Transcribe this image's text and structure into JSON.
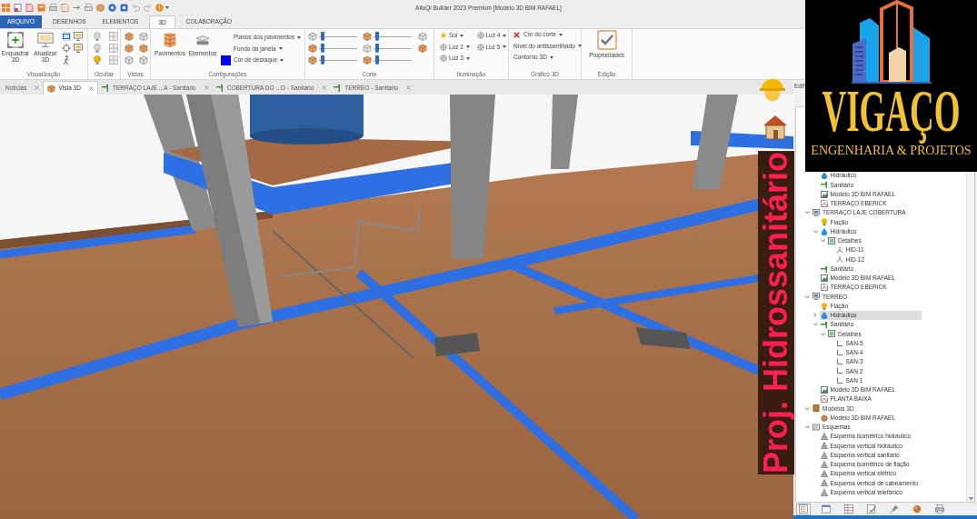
{
  "window": {
    "title": "AltoQi Builder 2023 Premium [Modelo 3D BIM RAFAEL]"
  },
  "ribbon": {
    "tabs": [
      {
        "label": "ARQUIVO",
        "kind": "file",
        "selected": false
      },
      {
        "label": "DESENHOS",
        "kind": "tab",
        "selected": false
      },
      {
        "label": "ELEMENTOS",
        "kind": "tab",
        "selected": false
      },
      {
        "label": "3D",
        "kind": "tab",
        "selected": true
      },
      {
        "label": "COLABORAÇÃO",
        "kind": "tab",
        "selected": false
      }
    ],
    "groups": [
      {
        "kind": "view",
        "label": "Visualização",
        "buttons": [
          {
            "label": "Enquadrar 3D"
          },
          {
            "label": "Atualizar 3D"
          }
        ]
      },
      {
        "kind": "hide",
        "label": "Ocultar"
      },
      {
        "kind": "views",
        "label": "Vistas"
      },
      {
        "kind": "config",
        "label": "Configurações",
        "buttons": [
          {
            "label": "Pavimentos"
          },
          {
            "label": "Elementos"
          }
        ],
        "dropdowns": [
          {
            "label": "Planos dos pavimentos"
          },
          {
            "label": "Fundo da janela"
          },
          {
            "label": "Cor de destaque",
            "color": "#0000ff"
          }
        ]
      },
      {
        "kind": "cut",
        "label": "Corte",
        "sliders": [
          {
            "level": 0.05
          },
          {
            "level": 0.05
          },
          {
            "level": 0.05
          },
          {
            "level": 0.05
          },
          {
            "level": 0.05
          },
          {
            "level": 0.05
          }
        ]
      },
      {
        "kind": "lighting",
        "label": "Iluminação",
        "lights": [
          {
            "label": "Sol",
            "kind": "sun"
          },
          {
            "label": "Luz 4",
            "kind": "lamp"
          },
          {
            "label": "Luz 2",
            "kind": "lamp"
          },
          {
            "label": "Luz 5",
            "kind": "lamp"
          },
          {
            "label": "Luz 3",
            "kind": "lamp"
          }
        ]
      },
      {
        "kind": "graphics",
        "label": "Gráfico 3D",
        "dropdowns": [
          {
            "label": "Cor do corte",
            "kind": "cutcolor"
          },
          {
            "label": "Nível do antisserrilhado",
            "kind": "plain"
          },
          {
            "label": "Contorno 3D",
            "kind": "plain"
          }
        ]
      },
      {
        "kind": "edit",
        "label": "Edição",
        "buttons": [
          {
            "label": "Propriedades"
          }
        ]
      }
    ]
  },
  "document_tabs": [
    {
      "label": "Notícias",
      "kind": "news",
      "selected": false
    },
    {
      "label": "Vista 3D",
      "kind": "view",
      "selected": true
    },
    {
      "label": "TERRAÇO LAJE ...A - Sanitário",
      "kind": "sanitary",
      "selected": false
    },
    {
      "label": "COBERTURA DO ...O - Sanitário",
      "kind": "sanitary",
      "selected": false
    },
    {
      "label": "TERREO - Sanitário",
      "kind": "sanitary",
      "selected": false
    }
  ],
  "side_panel": {
    "title": "Edif",
    "tree": [
      {
        "children": [
          {
            "label": "Hidráulico",
            "kind": "plumbing",
            "selected": false
          },
          {
            "label": "Sanitário",
            "kind": "sanitary",
            "selected": false
          },
          {
            "label": "Modelo 3D BIM RAFAEL",
            "kind": "model",
            "selected": false
          },
          {
            "label": "TERRAÇO EBERICK",
            "kind": "drawing",
            "selected": false
          }
        ]
      },
      {
        "label": "TERRAÇO LAJE COBERTURA",
        "kind": "floor",
        "selected": false,
        "expanded": true,
        "children": [
          {
            "label": "Fiação",
            "kind": "wiring",
            "selected": false
          },
          {
            "label": "Hidráulico",
            "kind": "plumbing",
            "selected": false,
            "expanded": true,
            "children": [
              {
                "label": "Detalhes",
                "kind": "details",
                "selected": false,
                "expanded": true,
                "children": [
                  {
                    "label": "HID-11",
                    "kind": "junction",
                    "selected": false
                  },
                  {
                    "label": "HID-12",
                    "kind": "junction",
                    "selected": false
                  }
                ]
              }
            ]
          },
          {
            "label": "Sanitário",
            "kind": "sanitary",
            "selected": false
          },
          {
            "label": "Modelo 3D BIM RAFAEL",
            "kind": "model",
            "selected": false
          },
          {
            "label": "TERRAÇO EBERICK",
            "kind": "drawing",
            "selected": false
          }
        ]
      },
      {
        "label": "TERREO",
        "kind": "floor",
        "selected": false,
        "expanded": true,
        "children": [
          {
            "label": "Fiação",
            "kind": "wiring",
            "selected": false
          },
          {
            "label": "Hidráulico",
            "kind": "plumbing",
            "selected": true,
            "expanded": false
          },
          {
            "label": "Sanitário",
            "kind": "sanitary",
            "selected": false,
            "expanded": true,
            "children": [
              {
                "label": "Detalhes",
                "kind": "details",
                "selected": false,
                "expanded": true,
                "children": [
                  {
                    "label": "SAN-5",
                    "kind": "elbow",
                    "selected": false
                  },
                  {
                    "label": "SAN-4",
                    "kind": "elbow",
                    "selected": false
                  },
                  {
                    "label": "SAN-3",
                    "kind": "elbow",
                    "selected": false
                  },
                  {
                    "label": "SAN 2",
                    "kind": "elbow",
                    "selected": false
                  },
                  {
                    "label": "SAN 1",
                    "kind": "elbow",
                    "selected": false
                  }
                ]
              }
            ]
          },
          {
            "label": "Modelo 3D BIM RAFAEL",
            "kind": "model",
            "selected": false
          },
          {
            "label": "PLANTA BAIXA",
            "kind": "drawing",
            "selected": false
          }
        ]
      },
      {
        "label": "Modelos 3D",
        "kind": "models",
        "selected": false,
        "expanded": true,
        "children": [
          {
            "label": "Modelo 3D BIM RAFAEL",
            "kind": "model3d",
            "selected": false
          }
        ]
      },
      {
        "label": "Esquemas",
        "kind": "schemes",
        "selected": false,
        "expanded": true,
        "children": [
          {
            "label": "Esquema isométrico hidráulico",
            "kind": "scheme",
            "selected": false
          },
          {
            "label": "Esquema vertical hidráulico",
            "kind": "scheme",
            "selected": false
          },
          {
            "label": "Esquema vertical sanitário",
            "kind": "scheme",
            "selected": false
          },
          {
            "label": "Esquema isométrico de fiação",
            "kind": "scheme",
            "selected": false
          },
          {
            "label": "Esquema vertical elétrico",
            "kind": "scheme",
            "selected": false
          },
          {
            "label": "Esquema vertical de cabeamento",
            "kind": "scheme",
            "selected": false
          },
          {
            "label": "Esquema vertical telefônico",
            "kind": "scheme",
            "selected": false
          }
        ]
      }
    ],
    "toolbar": [
      {
        "kind": "tree",
        "selected": true
      },
      {
        "kind": "window",
        "selected": false
      },
      {
        "kind": "table",
        "selected": false
      },
      {
        "kind": "checklist",
        "selected": false
      },
      {
        "kind": "pin",
        "selected": false
      },
      {
        "kind": "sphere",
        "selected": false
      },
      {
        "kind": "printer",
        "selected": false
      }
    ]
  },
  "overlay": {
    "logo": {
      "name": "VIGAÇO",
      "tagline": "ENGENHARIA & PROJETOS"
    },
    "caption": "Proj. Hidrossanitário"
  }
}
